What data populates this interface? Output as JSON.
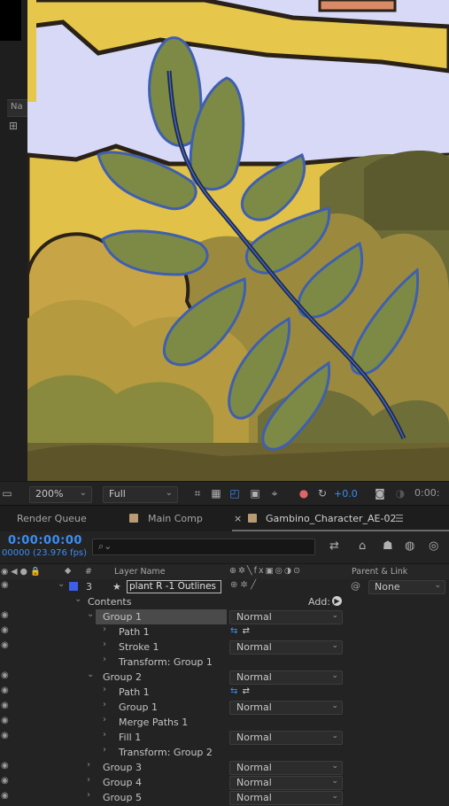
{
  "left_panel": {
    "column_label": "Na"
  },
  "viewer": {
    "zoom": "200%",
    "resolution": "Full",
    "exposure": "+0.0",
    "time_short": "0:00:"
  },
  "tabs": [
    {
      "label": "Render Queue"
    },
    {
      "label": "Main Comp"
    },
    {
      "label": "Gambino_Character_AE-02",
      "active": true
    }
  ],
  "timeline": {
    "timecode": "0:00:00:00",
    "fps": "00000 (23.976 fps)",
    "search_placeholder": "",
    "columns": {
      "number": "#",
      "layer_name": "Layer Name",
      "parent_link": "Parent & Link"
    },
    "layer": {
      "number": "3",
      "name": "plant R -1 Outlines",
      "parent": "None",
      "label_color": "#3d5ee8"
    },
    "contents_label": "Contents",
    "add_label": "Add:",
    "rows": [
      {
        "name": "Group 1",
        "mode": "Normal",
        "eye": true,
        "indent": 1,
        "expanded": true,
        "selected": true
      },
      {
        "name": "Path 1",
        "mode": "",
        "eye": true,
        "indent": 2,
        "expanded": false,
        "path_icons": true
      },
      {
        "name": "Stroke 1",
        "mode": "Normal",
        "eye": true,
        "indent": 2,
        "expanded": false
      },
      {
        "name": "Transform: Group 1",
        "mode": "",
        "eye": false,
        "indent": 2,
        "expanded": false
      },
      {
        "name": "Group 2",
        "mode": "Normal",
        "eye": true,
        "indent": 1,
        "expanded": true
      },
      {
        "name": "Path 1",
        "mode": "",
        "eye": true,
        "indent": 2,
        "expanded": false,
        "path_icons": true
      },
      {
        "name": "Group 1",
        "mode": "Normal",
        "eye": true,
        "indent": 2,
        "expanded": false
      },
      {
        "name": "Merge Paths 1",
        "mode": "",
        "eye": true,
        "indent": 2,
        "expanded": false
      },
      {
        "name": "Fill 1",
        "mode": "Normal",
        "eye": true,
        "indent": 2,
        "expanded": false
      },
      {
        "name": "Transform: Group 2",
        "mode": "",
        "eye": false,
        "indent": 2,
        "expanded": false
      },
      {
        "name": "Group 3",
        "mode": "Normal",
        "eye": true,
        "indent": 1,
        "expanded": false
      },
      {
        "name": "Group 4",
        "mode": "Normal",
        "eye": true,
        "indent": 1,
        "expanded": false
      },
      {
        "name": "Group 5",
        "mode": "Normal",
        "eye": true,
        "indent": 1,
        "expanded": false
      }
    ]
  },
  "icons": {
    "eye": "eye-icon",
    "search": "search-icon",
    "twirl_open": "chevron-down-icon",
    "twirl_closed": "chevron-right-icon",
    "add": "add-play-icon"
  },
  "colors": {
    "accent_blue": "#3b8df1",
    "leaf_fill": "#7c8a45",
    "leaf_outline": "#3f5fb0"
  }
}
